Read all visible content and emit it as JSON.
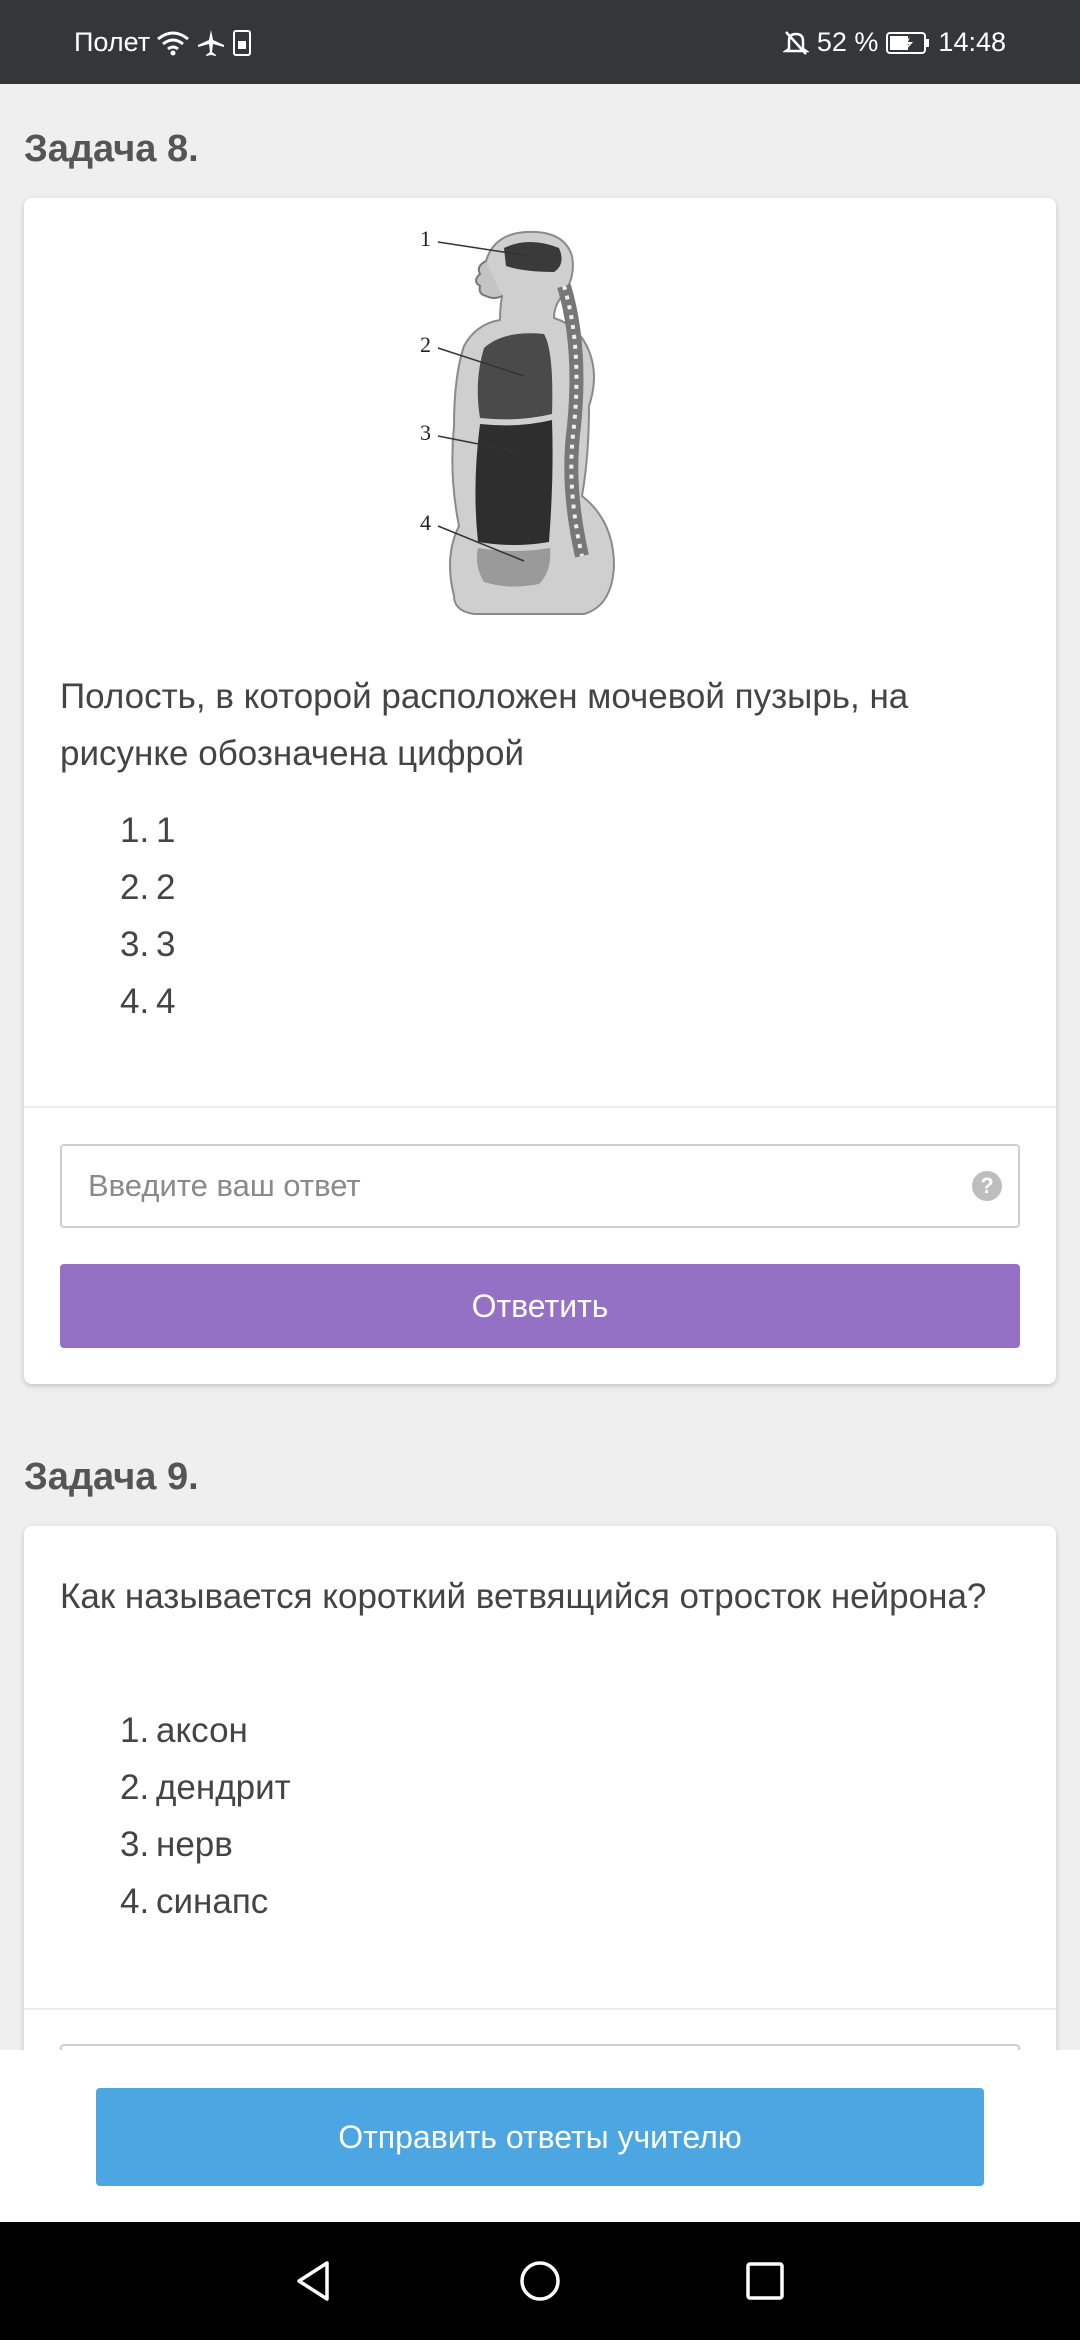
{
  "status_bar": {
    "carrier": "Полет",
    "battery_percent": "52 %",
    "time": "14:48"
  },
  "tasks": [
    {
      "title": "Задача 8.",
      "figure_labels": [
        "1",
        "2",
        "3",
        "4"
      ],
      "question": "Полость, в которой расположен мочевой пузырь, на рисунке обозначена цифрой",
      "options": [
        {
          "num": "1.",
          "text": "1"
        },
        {
          "num": "2.",
          "text": "2"
        },
        {
          "num": "3.",
          "text": "3"
        },
        {
          "num": "4.",
          "text": "4"
        }
      ],
      "answer_placeholder": "Введите ваш ответ",
      "help_symbol": "?",
      "submit_label": "Ответить"
    },
    {
      "title": "Задача 9.",
      "question": "Как называется короткий ветвящийся отросток нейрона?",
      "options": [
        {
          "num": "1.",
          "text": "аксон"
        },
        {
          "num": "2.",
          "text": "дендрит"
        },
        {
          "num": "3.",
          "text": "нерв"
        },
        {
          "num": "4.",
          "text": "синапс"
        }
      ]
    }
  ],
  "footer": {
    "send_label": "Отправить ответы учителю"
  },
  "colors": {
    "submit": "#9471c4",
    "send": "#4ca6e1"
  }
}
